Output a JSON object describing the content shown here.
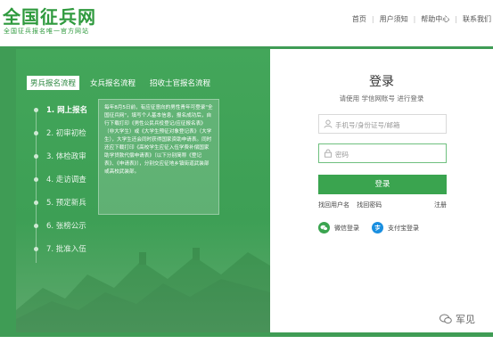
{
  "header": {
    "logo_title": "全国征兵网",
    "logo_subtitle": "全国征兵报名唯一官方网站",
    "nav": [
      "首页",
      "用户须知",
      "帮助中心",
      "联系我们"
    ]
  },
  "tabs": [
    "男兵报名流程",
    "女兵报名流程",
    "招收士官报名流程"
  ],
  "steps": [
    "1. 网上报名",
    "2. 初审初检",
    "3. 体检政审",
    "4. 走访调查",
    "5. 预定新兵",
    "6. 张榜公示",
    "7. 批准入伍"
  ],
  "note": "每年8月5日前，有应征意向的男性青年可登录\"全国征兵网\"，填写个人基本信息，报名成功后，自行下载打印《男性公民兵役登记/应征报名表》（非大学生）或《大学生预征对象登记表》（大学生），大学生还会同时获得国家资助申请表。同时还应下载打印《高校学生应征入伍学费补偿国家助学贷款代偿申请表》（以下分别简称《登记表》、《申请表》），分别交应征地乡镇街道武装部或高校武装部。",
  "login": {
    "title": "登录",
    "subtitle": "请使用 学信网账号 进行登录",
    "username_placeholder": "手机号/身份证号/邮箱",
    "password_placeholder": "密码",
    "login_button": "登录",
    "find_username": "找回用户名",
    "find_password": "找回密码",
    "register": "注册",
    "wechat": "微信登录",
    "alipay": "支付宝登录"
  },
  "watermark": "军见",
  "colors": {
    "brand_green": "#3aa44f",
    "dark_green": "#2f9a3e"
  }
}
